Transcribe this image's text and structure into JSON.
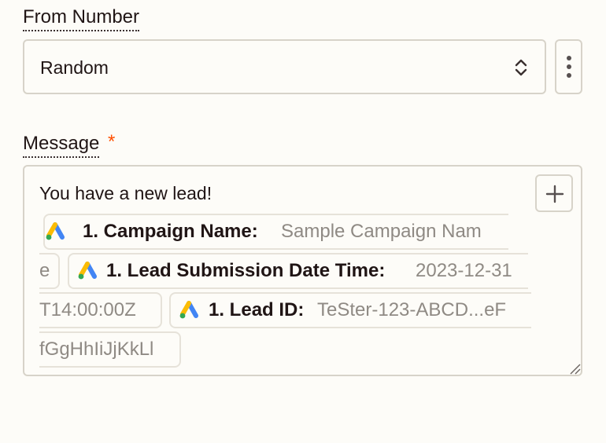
{
  "from_number": {
    "label": "From Number",
    "value": "Random"
  },
  "message": {
    "label": "Message",
    "required_marker": "*",
    "text": "You have a new lead!",
    "pills": [
      {
        "name": "1. Campaign Name:",
        "value": "Sample Campaign Nam",
        "value_wrap": "e",
        "icon": "google-ads-icon"
      },
      {
        "name": "1. Lead Submission Date Time:",
        "value": "2023-12-31",
        "value_wrap": "T14:00:00Z",
        "icon": "google-ads-icon"
      },
      {
        "name": "1. Lead ID:",
        "value": "TeSter-123-ABCD...eF",
        "value_wrap": "fGgHhIiJjKkLl",
        "icon": "google-ads-icon"
      }
    ]
  },
  "icons": {
    "select": "chevron-up-down-icon",
    "more": "kebab-menu-icon",
    "insert": "plus-icon",
    "resize": "resize-handle-icon"
  },
  "colors": {
    "background": "#fdfcf8",
    "border": "#d7d3c9",
    "required": "#ff4f00",
    "pill_value": "#8f8a84"
  }
}
